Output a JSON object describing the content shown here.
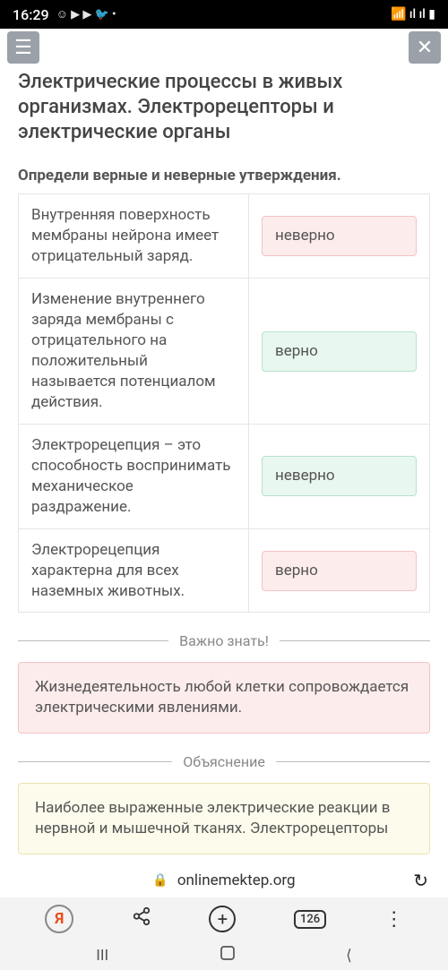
{
  "status": {
    "time": "16:29",
    "icons_left": "☺ ▶ ▶ 🐦 •",
    "icons_right": "📶 ıl ıl ▮"
  },
  "page": {
    "title": "Электрические процессы в живых организмах. Электрорецепторы и электрические органы",
    "instruction": "Определи верные и неверные утверждения."
  },
  "rows": [
    {
      "statement": "Внутренняя поверхность мембраны нейрона имеет отрицательный заряд.",
      "answer": "неверно",
      "color": "red"
    },
    {
      "statement": "Изменение внутреннего заряда мембраны с отрицательного на положительный называется потенциалом действия.",
      "answer": "верно",
      "color": "green"
    },
    {
      "statement": "Электрорецепция – это способность воспринимать механическое раздражение.",
      "answer": "неверно",
      "color": "green"
    },
    {
      "statement": "Электрорецепция характерна для всех наземных животных.",
      "answer": "верно",
      "color": "red"
    }
  ],
  "sections": {
    "important_header": "Важно знать!",
    "important_text": "Жизнедеятельность любой клетки сопровождается электрическими явлениями.",
    "explanation_header": "Объяснение",
    "explanation_text": "Наиболее выраженные электрические реакции в нервной и мышечной тканях. Электрорецепторы"
  },
  "browser": {
    "domain": "onlinemektep.org",
    "tab_count": "126"
  }
}
